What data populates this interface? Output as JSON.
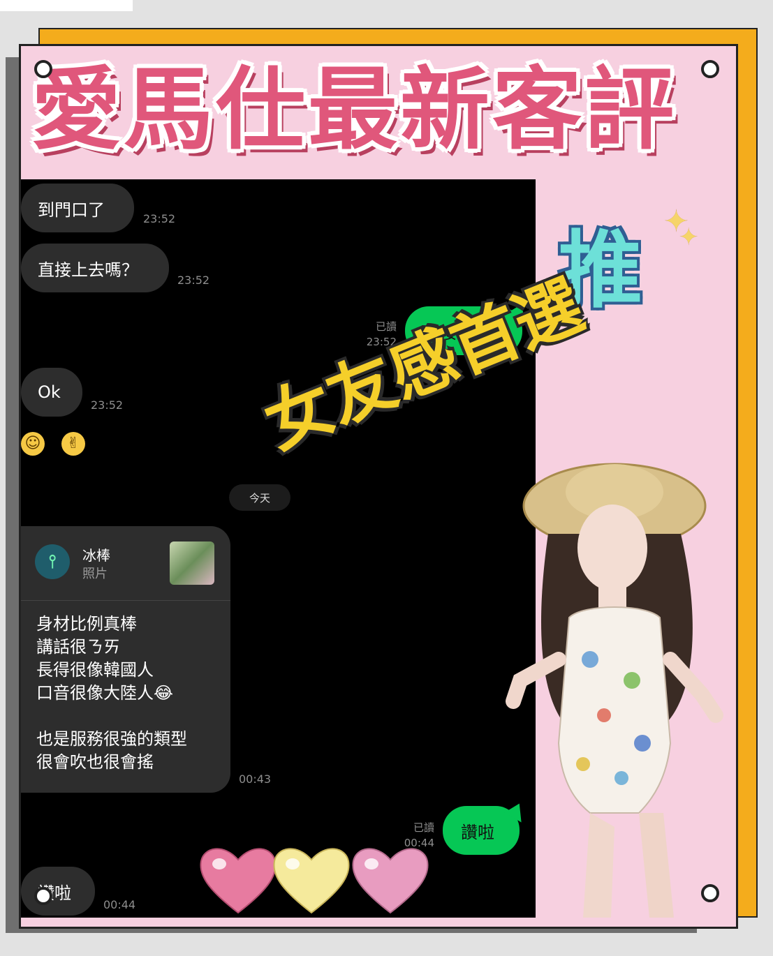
{
  "title": "愛馬仕最新客評",
  "chat": {
    "messages_top": [
      {
        "text": "到門口了",
        "time": "23:52"
      },
      {
        "text": "直接上去嗎？",
        "time": "23:52"
      }
    ],
    "reply1": {
      "text": "直接上樓",
      "read": "已讀",
      "time": "23:52"
    },
    "ok": {
      "text": "Ok",
      "time": "23:52"
    },
    "emoji1": "☺",
    "emoji2": "✌",
    "date_divider": "今天",
    "card": {
      "name": "冰棒",
      "subtitle": "照片",
      "body": "身材比例真棒\n講話很ㄋㄞ\n長得很像韓國人\n口音很像大陸人😂\n\n也是服務很強的類型\n很會吹也很會搖",
      "time": "00:43"
    },
    "reply2": {
      "text": "讚啦",
      "read": "已讀",
      "time": "00:44"
    },
    "last": {
      "text": "讚啦",
      "time": "00:44"
    }
  },
  "badge_tui": "推",
  "slogan": "女友感首選",
  "colors": {
    "title_pink": "#e0577b",
    "card_bg": "#f7d0e0",
    "line_green": "#06c755",
    "accent_orange": "#f4ac1c",
    "slogan_yellow": "#f5cf2a"
  }
}
